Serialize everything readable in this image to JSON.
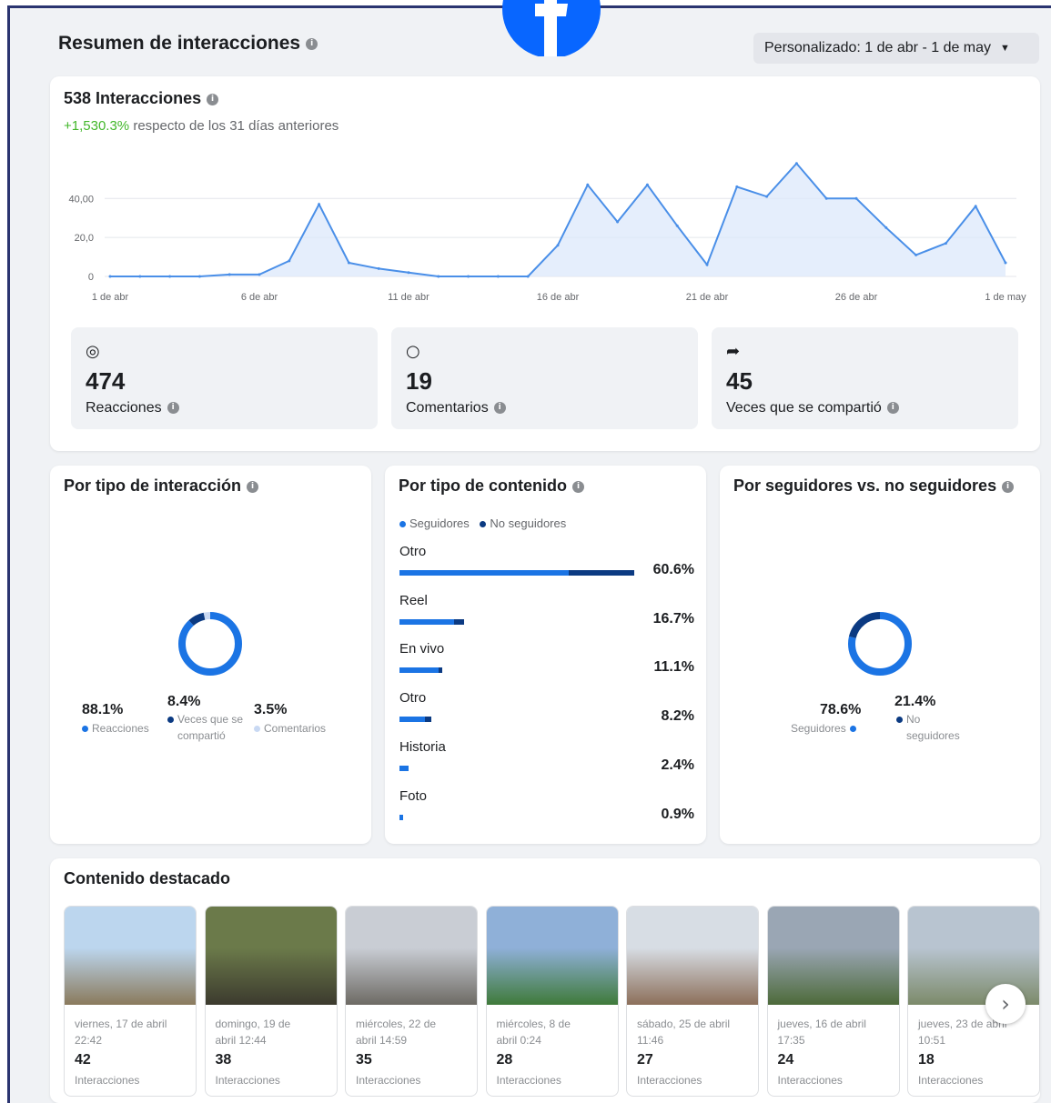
{
  "header": {
    "title": "Resumen de interacciones",
    "date_range": "Personalizado: 1 de abr - 1 de may"
  },
  "summary": {
    "total_label": "538 Interacciones",
    "delta_value": "+1,530.3%",
    "delta_text": " respecto de los 31 días anteriores"
  },
  "chart_data": {
    "type": "area",
    "title": "538 Interacciones",
    "ytick_labels": [
      "40,00",
      "20,0",
      "0"
    ],
    "ytick_values": [
      40,
      20,
      0
    ],
    "ylim": [
      0,
      56
    ],
    "xtick_labels": [
      "1 de abr",
      "6 de abr",
      "11 de abr",
      "16 de abr",
      "21 de abr",
      "26 de abr",
      "1 de may"
    ],
    "xtick_positions": [
      1,
      6,
      11,
      16,
      21,
      26,
      31
    ],
    "x": [
      1,
      2,
      3,
      4,
      5,
      6,
      7,
      8,
      9,
      10,
      11,
      12,
      13,
      14,
      15,
      16,
      17,
      18,
      19,
      20,
      21,
      22,
      23,
      24,
      25,
      26,
      27,
      28,
      29,
      30,
      31
    ],
    "values": [
      0,
      0,
      0,
      0,
      1,
      1,
      8,
      37,
      7,
      4,
      2,
      0,
      0,
      0,
      0,
      16,
      47,
      28,
      47,
      26,
      6,
      46,
      41,
      58,
      40,
      40,
      25,
      11,
      17,
      36,
      7
    ],
    "grid": true,
    "color": "#4a8fe8"
  },
  "stats": [
    {
      "value": "474",
      "label": "Reacciones"
    },
    {
      "value": "19",
      "label": "Comentarios"
    },
    {
      "value": "45",
      "label": "Veces que se compartió"
    }
  ],
  "interaction_type": {
    "title": "Por tipo de interacción",
    "items": [
      {
        "pct": "88.1%",
        "label": "Reacciones"
      },
      {
        "pct": "8.4%",
        "label_a": "Veces que se",
        "label_b": "compartió"
      },
      {
        "pct": "3.5%",
        "label": "Comentarios"
      }
    ],
    "donut_values": [
      88.1,
      8.4,
      3.5
    ]
  },
  "content_type": {
    "title": "Por tipo de contenido",
    "legend": [
      "Seguidores",
      "No seguidores"
    ],
    "items": [
      {
        "label": "Otro",
        "pct": "60.6%",
        "value": 60.6,
        "followers_share": 0.72
      },
      {
        "label": "Reel",
        "pct": "16.7%",
        "value": 16.7,
        "followers_share": 0.85
      },
      {
        "label": "En vivo",
        "pct": "11.1%",
        "value": 11.1,
        "followers_share": 0.9
      },
      {
        "label": "Otro",
        "pct": "8.2%",
        "value": 8.2,
        "followers_share": 0.8
      },
      {
        "label": "Historia",
        "pct": "2.4%",
        "value": 2.4,
        "followers_share": 1.0
      },
      {
        "label": "Foto",
        "pct": "0.9%",
        "value": 0.9,
        "followers_share": 1.0
      }
    ]
  },
  "followers": {
    "title": "Por seguidores vs. no seguidores",
    "items": [
      {
        "pct": "78.6%",
        "label": "Seguidores"
      },
      {
        "pct": "21.4%",
        "label_a": "No",
        "label_b": "seguidores"
      }
    ],
    "donut_values": [
      78.6,
      21.4
    ]
  },
  "featured": {
    "title": "Contenido destacado",
    "posts": [
      {
        "date_a": "viernes, 17 de abril",
        "date_b": "22:42",
        "count": "42",
        "label": "Interacciones"
      },
      {
        "date_a": "domingo, 19 de",
        "date_b": "abril 12:44",
        "count": "38",
        "label": "Interacciones"
      },
      {
        "date_a": "miércoles, 22 de",
        "date_b": "abril 14:59",
        "count": "35",
        "label": "Interacciones"
      },
      {
        "date_a": "miércoles, 8 de",
        "date_b": "abril 0:24",
        "count": "28",
        "label": "Interacciones"
      },
      {
        "date_a": "sábado, 25 de abril",
        "date_b": "11:46",
        "count": "27",
        "label": "Interacciones"
      },
      {
        "date_a": "jueves, 16 de abril",
        "date_b": "17:35",
        "count": "24",
        "label": "Interacciones"
      },
      {
        "date_a": "jueves, 23 de abril",
        "date_b": "10:51",
        "count": "18",
        "label": "Interacciones"
      }
    ]
  },
  "colors": {
    "followers": "#1b74e4",
    "non_followers": "#0b3a82",
    "third": "#c9d9f3",
    "brand": "#0866ff"
  },
  "icons": [
    "reactions-icon",
    "comment-icon",
    "share-icon",
    "info-icon",
    "chevron-right-icon",
    "facebook-logo-icon"
  ]
}
